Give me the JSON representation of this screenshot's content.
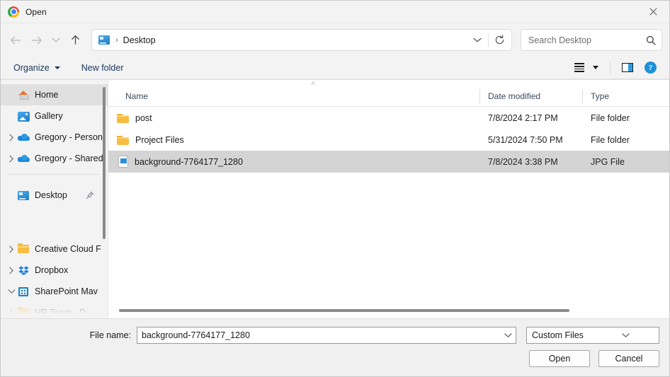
{
  "window": {
    "title": "Open",
    "app_icon": "chrome-icon",
    "close_label": "✕"
  },
  "nav": {
    "back": "back-arrow-icon",
    "forward": "forward-arrow-icon",
    "recent": "chevron-down-icon",
    "up": "up-arrow-icon",
    "refresh": "refresh-icon",
    "breadcrumb_icon": "desktop-icon",
    "breadcrumb_separator": "›",
    "breadcrumb": "Desktop",
    "address_caret": "chevron-down-icon"
  },
  "search": {
    "placeholder": "Search Desktop",
    "value": "",
    "icon": "search-icon"
  },
  "command_bar": {
    "organize": "Organize",
    "new_folder": "New folder",
    "view_icon": "list-view-icon",
    "view_caret": "chevron-down-icon",
    "preview_pane_icon": "preview-pane-icon",
    "help_icon": "help-icon",
    "help_glyph": "?"
  },
  "sidebar": {
    "items": [
      {
        "label": "Home",
        "icon": "home-icon",
        "chevron": false,
        "selected": true,
        "pinned": false
      },
      {
        "label": "Gallery",
        "icon": "gallery-icon",
        "chevron": false,
        "selected": false,
        "pinned": false
      },
      {
        "label": "Gregory - Person",
        "icon": "onedrive-cloud-icon",
        "chevron": true,
        "selected": false,
        "pinned": false
      },
      {
        "label": "Gregory - Shared",
        "icon": "onedrive-cloud-icon",
        "chevron": true,
        "selected": false,
        "pinned": false
      },
      {
        "label": "Desktop",
        "icon": "desktop-icon",
        "chevron": false,
        "selected": false,
        "pinned": true
      },
      {
        "label": "Creative Cloud F",
        "icon": "folder-icon",
        "chevron": true,
        "selected": false,
        "pinned": false
      },
      {
        "label": "Dropbox",
        "icon": "dropbox-icon",
        "chevron": true,
        "selected": false,
        "pinned": false
      },
      {
        "label": "SharePoint Mav",
        "icon": "sharepoint-icon",
        "chevron": true,
        "expanded": true,
        "selected": false,
        "pinned": false
      },
      {
        "label": "HR Team - D",
        "icon": "folder-icon",
        "chevron": true,
        "selected": false,
        "pinned": false
      }
    ]
  },
  "filelist": {
    "sort_indicator": "˄",
    "columns": [
      {
        "key": "name",
        "label": "Name"
      },
      {
        "key": "date",
        "label": "Date modified"
      },
      {
        "key": "type",
        "label": "Type"
      }
    ],
    "rows": [
      {
        "name": "post",
        "date": "7/8/2024 2:17 PM",
        "type": "File folder",
        "icon": "folder-icon",
        "selected": false
      },
      {
        "name": "Project Files",
        "date": "5/31/2024 7:50 PM",
        "type": "File folder",
        "icon": "folder-icon",
        "selected": false
      },
      {
        "name": "background-7764177_1280",
        "date": "7/8/2024 3:38 PM",
        "type": "JPG File",
        "icon": "jpg-file-icon",
        "selected": true
      }
    ]
  },
  "footer": {
    "file_name_label": "File name:",
    "file_name_value": "background-7764177_1280",
    "file_name_caret": "chevron-down-icon",
    "file_type_value": "Custom Files",
    "file_type_caret": "chevron-down-icon",
    "open_button": "Open",
    "cancel_button": "Cancel"
  },
  "colors": {
    "accent": "#2e8fd6",
    "selection": "#d4d4d4",
    "command_text": "#17365d",
    "folder": "#f6bd42"
  }
}
